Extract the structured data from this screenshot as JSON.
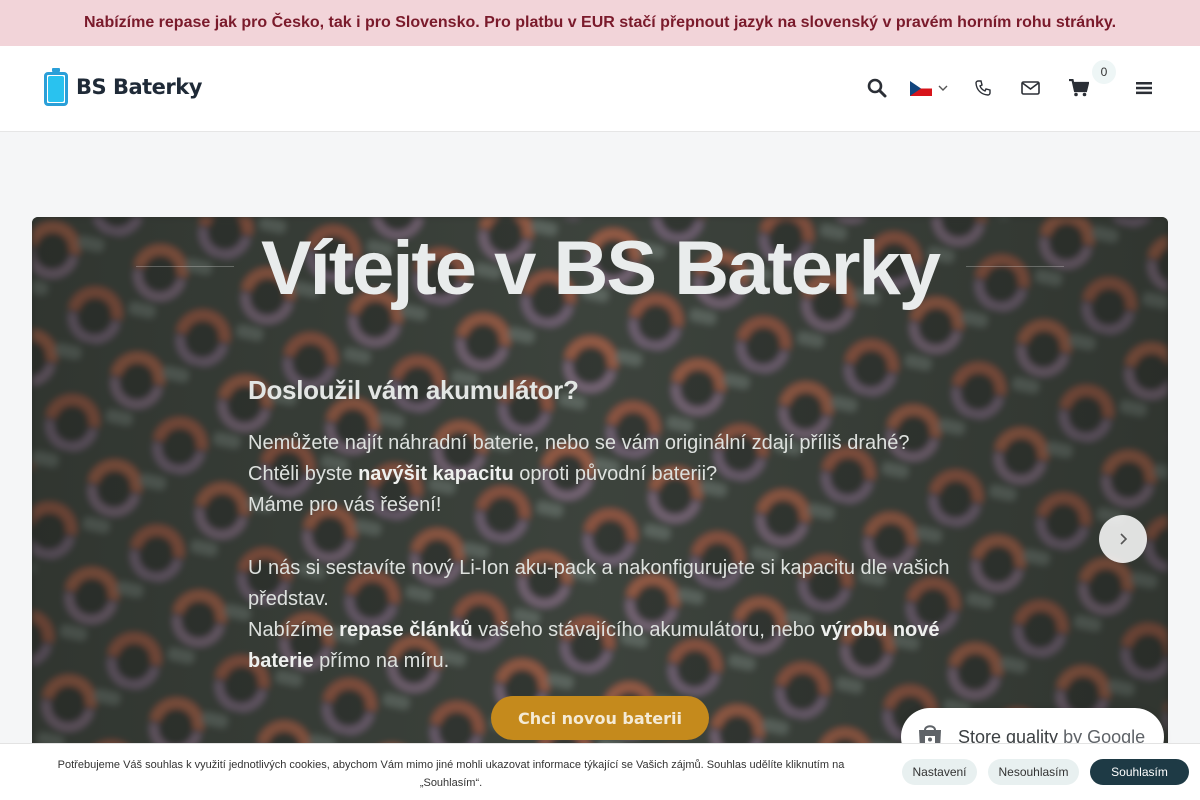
{
  "announcement": "Nabízíme repase jak pro Česko, tak i pro Slovensko. Pro platbu v EUR stačí přepnout jazyk na slovenský v pravém horním rohu stránky.",
  "header": {
    "logo_text": "BS Baterky",
    "cart_count": "0",
    "icons": [
      "search-icon",
      "czech-flag-icon",
      "chevron-down-icon",
      "phone-icon",
      "envelope-icon",
      "cart-icon",
      "menu-icon"
    ]
  },
  "hero": {
    "title": "Vítejte v BS Baterky",
    "subtitle": "Dosloužil vám akumulátor?",
    "p1_line1": "Nemůžete najít náhradní baterie, nebo se vám originální zdají příliš drahé?",
    "p1_line2_a": "Chtěli byste ",
    "p1_line2_b": "navýšit kapacitu",
    "p1_line2_c": " oproti původní baterii?",
    "p1_line3": "Máme pro vás řešení!",
    "p2_line1": "U nás si sestavíte nový Li-Ion aku-pack a nakonfigurujete si kapacitu dle vašich představ.",
    "p2_line2_a": "Nabízíme ",
    "p2_line2_b": "repase článků",
    "p2_line2_c": " vašeho stávajícího akumulátoru, nebo ",
    "p2_line2_d": "výrobu nové baterie",
    "p2_line2_e": " přímo na míru.",
    "button": "Chci novou baterii"
  },
  "google_badge": {
    "label": "Store quality",
    "by": "by Google"
  },
  "cookies": {
    "text": "Potřebujeme Váš souhlas k využití jednotlivých cookies, abychom Vám mimo jiné mohli ukazovat informace týkající se Vašich zájmů. Souhlas udělíte kliknutím na „Souhlasím“.",
    "settings": "Nastavení",
    "decline": "Nesouhlasím",
    "accept": "Souhlasím"
  },
  "colors": {
    "announcement_bg": "#f2d4d9",
    "announcement_text": "#7a1a2b",
    "brand_blue": "#2a9fd8",
    "cta": "#c58a1c",
    "cookie_accept_bg": "#1e3a45"
  }
}
